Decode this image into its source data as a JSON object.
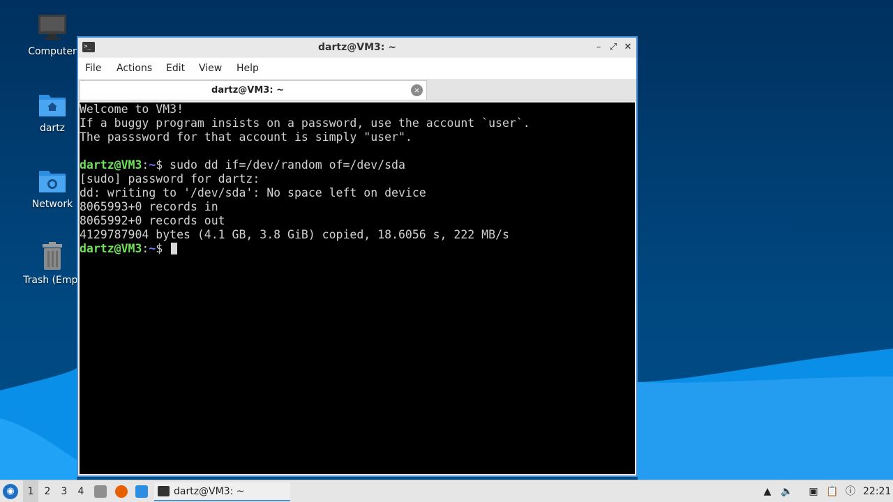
{
  "desktop": {
    "icons": [
      {
        "label": "Computer",
        "icon": "computer-icon"
      },
      {
        "label": "dartz",
        "icon": "home-folder-icon"
      },
      {
        "label": "Network",
        "icon": "network-folder-icon"
      },
      {
        "label": "Trash (Empt",
        "icon": "trash-icon"
      }
    ]
  },
  "window": {
    "title": "dartz@VM3: ~",
    "controls": {
      "minimize": "–",
      "maximize": "⤢",
      "close": "✕"
    },
    "menu": [
      "File",
      "Actions",
      "Edit",
      "View",
      "Help"
    ],
    "tab": {
      "label": "dartz@VM3: ~",
      "close": "×"
    }
  },
  "terminal": {
    "line1": "Welcome to VM3!",
    "line2": "If a buggy program insists on a password, use the account `user`.",
    "line3": "The passsword for that account is simply \"user\".",
    "prompt_user": "dartz@VM3",
    "prompt_colon": ":",
    "prompt_path": "~",
    "prompt_symbol": "$ ",
    "command": "sudo dd if=/dev/random of=/dev/sda",
    "out1": "[sudo] password for dartz:",
    "out2": "dd: writing to '/dev/sda': No space left on device",
    "out3": "8065993+0 records in",
    "out4": "8065992+0 records out",
    "out5": "4129787904 bytes (4.1 GB, 3.8 GiB) copied, 18.6056 s, 222 MB/s"
  },
  "taskbar": {
    "workspaces": [
      "1",
      "2",
      "3",
      "4"
    ],
    "active_workspace": "1",
    "task_label": "dartz@VM3: ~",
    "clock": "22:21"
  },
  "colors": {
    "accent": "#4a90d9",
    "prompt_user": "#6fe05a",
    "prompt_path": "#6a7cff",
    "desktop_bg": "#00305e",
    "wave": "#0a8fe8"
  }
}
